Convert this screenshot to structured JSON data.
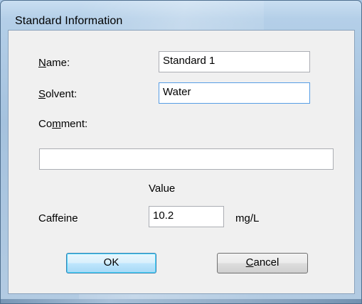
{
  "dialog": {
    "title": "Standard Information"
  },
  "form": {
    "name_label_mnemonic": "N",
    "name_label_rest": "ame:",
    "name_value": "Standard 1",
    "solvent_label_mnemonic": "S",
    "solvent_label_rest": "olvent:",
    "solvent_value": "Water",
    "comment_label_prefix": "Co",
    "comment_label_mnemonic": "m",
    "comment_label_rest": "ment:",
    "comment_value": "",
    "value_header": "Value",
    "component_name": "Caffeine",
    "component_value": "10.2",
    "component_unit": "mg/L"
  },
  "buttons": {
    "ok_label": "OK",
    "cancel_label_mnemonic": "C",
    "cancel_label_rest": "ancel"
  },
  "colors": {
    "window_frame": "#a5c2de",
    "client_background": "#f0f0f0",
    "focus_border": "#569de5",
    "default_button_border": "#3c7fb1"
  }
}
